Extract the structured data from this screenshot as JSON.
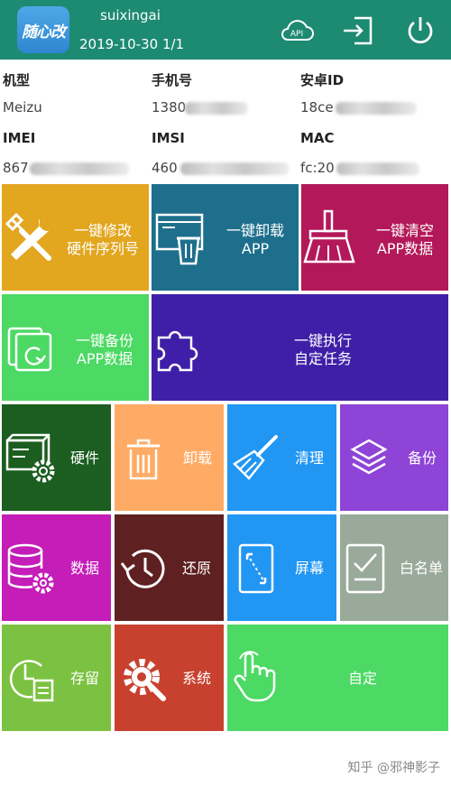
{
  "header": {
    "logo_text": "随心改",
    "username": "suixingai",
    "date": "2019-10-30 1/1",
    "api_label": "API"
  },
  "info": {
    "model_label": "机型",
    "model_value": "Meizu",
    "phone_label": "手机号",
    "phone_value": "1380",
    "androidid_label": "安卓ID",
    "androidid_value": "18ce",
    "imei_label": "IMEI",
    "imei_value": "867",
    "imsi_label": "IMSI",
    "imsi_value": "460",
    "mac_label": "MAC",
    "mac_value": "fc:20"
  },
  "tiles": {
    "modify": {
      "line1": "一键修改",
      "line2": "硬件序列号",
      "color": "#e2a61f"
    },
    "uninstall": {
      "line1": "一键卸载",
      "line2": "APP",
      "color": "#1e6f8c"
    },
    "clear": {
      "line1": "一键清空",
      "line2": "APP数据",
      "color": "#b3195a"
    },
    "backup": {
      "line1": "一键备份",
      "line2": "APP数据",
      "color": "#4cd964"
    },
    "run": {
      "line1": "一键执行",
      "line2": "自定任务",
      "color": "#3f1fa8"
    },
    "hardware": {
      "label": "硬件",
      "color": "#1b5e20"
    },
    "unload": {
      "label": "卸载",
      "color": "#ffab66"
    },
    "cleanup": {
      "label": "清理",
      "color": "#2196f3"
    },
    "backup_s": {
      "label": "备份",
      "color": "#8e44d6"
    },
    "data": {
      "label": "数据",
      "color": "#c41db8"
    },
    "restore": {
      "label": "还原",
      "color": "#5e2020"
    },
    "screen": {
      "label": "屏幕",
      "color": "#2196f3"
    },
    "whitelist": {
      "label": "白名单",
      "color": "#9aaa9a"
    },
    "save": {
      "label": "存留",
      "color": "#7cc242"
    },
    "system": {
      "label": "系统",
      "color": "#c8412f"
    },
    "custom": {
      "label": "自定",
      "color": "#4cd964"
    }
  },
  "watermark": "知乎 @邪神影子"
}
